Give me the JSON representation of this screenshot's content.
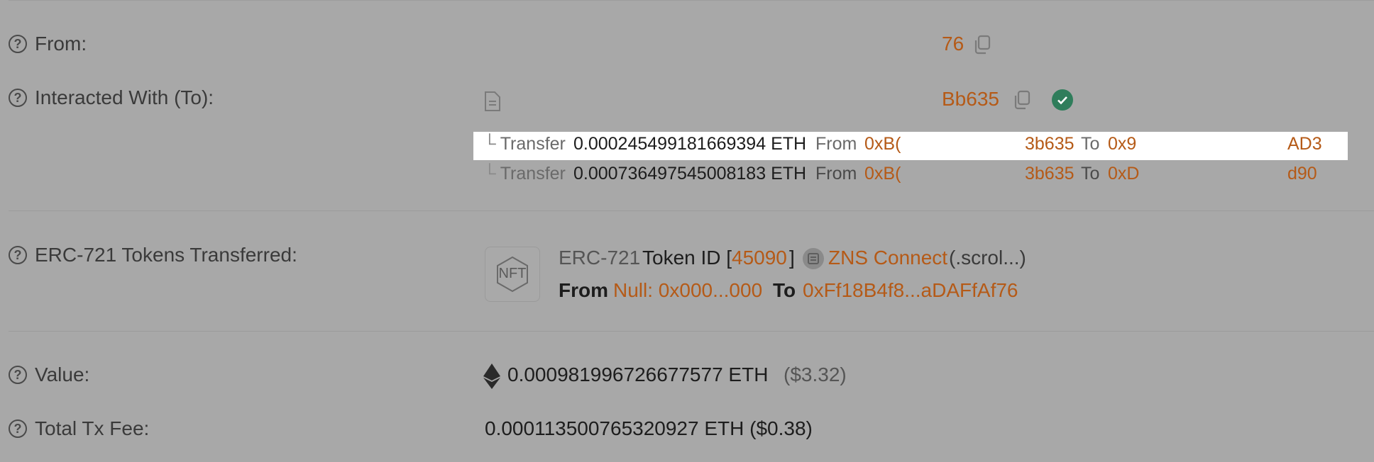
{
  "rows": {
    "from": {
      "label": "From:",
      "address_tail": "76"
    },
    "interacted": {
      "label": "Interacted With (To):",
      "address_tail": "Bb635"
    },
    "transfers": [
      {
        "word": "Transfer",
        "amount": "0.000245499181669394 ETH",
        "from_word": "From",
        "from_addr_head": "0xB(",
        "from_addr_tail": "3b635",
        "to_word": "To",
        "to_addr_head": "0x9",
        "to_addr_tail": "AD3"
      },
      {
        "word": "Transfer",
        "amount": "0.000736497545008183 ETH",
        "from_word": "From",
        "from_addr_head": "0xB(",
        "from_addr_tail": "3b635",
        "to_word": "To",
        "to_addr_head": "0xD",
        "to_addr_tail": "d90"
      }
    ],
    "erc721": {
      "label": "ERC-721 Tokens Transferred:",
      "nft_icon_text": "NFT",
      "standard": "ERC-721",
      "token_id_prefix": "Token ID [",
      "token_id": "45090",
      "token_id_suffix": "]",
      "collection": "ZNS Connect",
      "collection_suffix": "(.scrol...)",
      "from_word": "From",
      "from_addr": "Null: 0x000...000",
      "to_word": "To",
      "to_addr": "0xFf18B4f8...aDAFfAf76"
    },
    "value": {
      "label": "Value:",
      "amount": "0.000981996726677577 ETH",
      "usd": "($3.32)"
    },
    "fee": {
      "label": "Total Tx Fee:",
      "amount": "0.000113500765320927 ETH ($0.38)"
    }
  },
  "icons": {
    "help": "question-circle-icon",
    "copy": "copy-icon",
    "contract": "document-icon",
    "verified": "check-circle-icon",
    "eth": "ethereum-icon",
    "token": "token-logo-icon"
  },
  "colors": {
    "background": "#a8a8a8",
    "link": "#b55a17",
    "verified": "#2f7d5b"
  }
}
